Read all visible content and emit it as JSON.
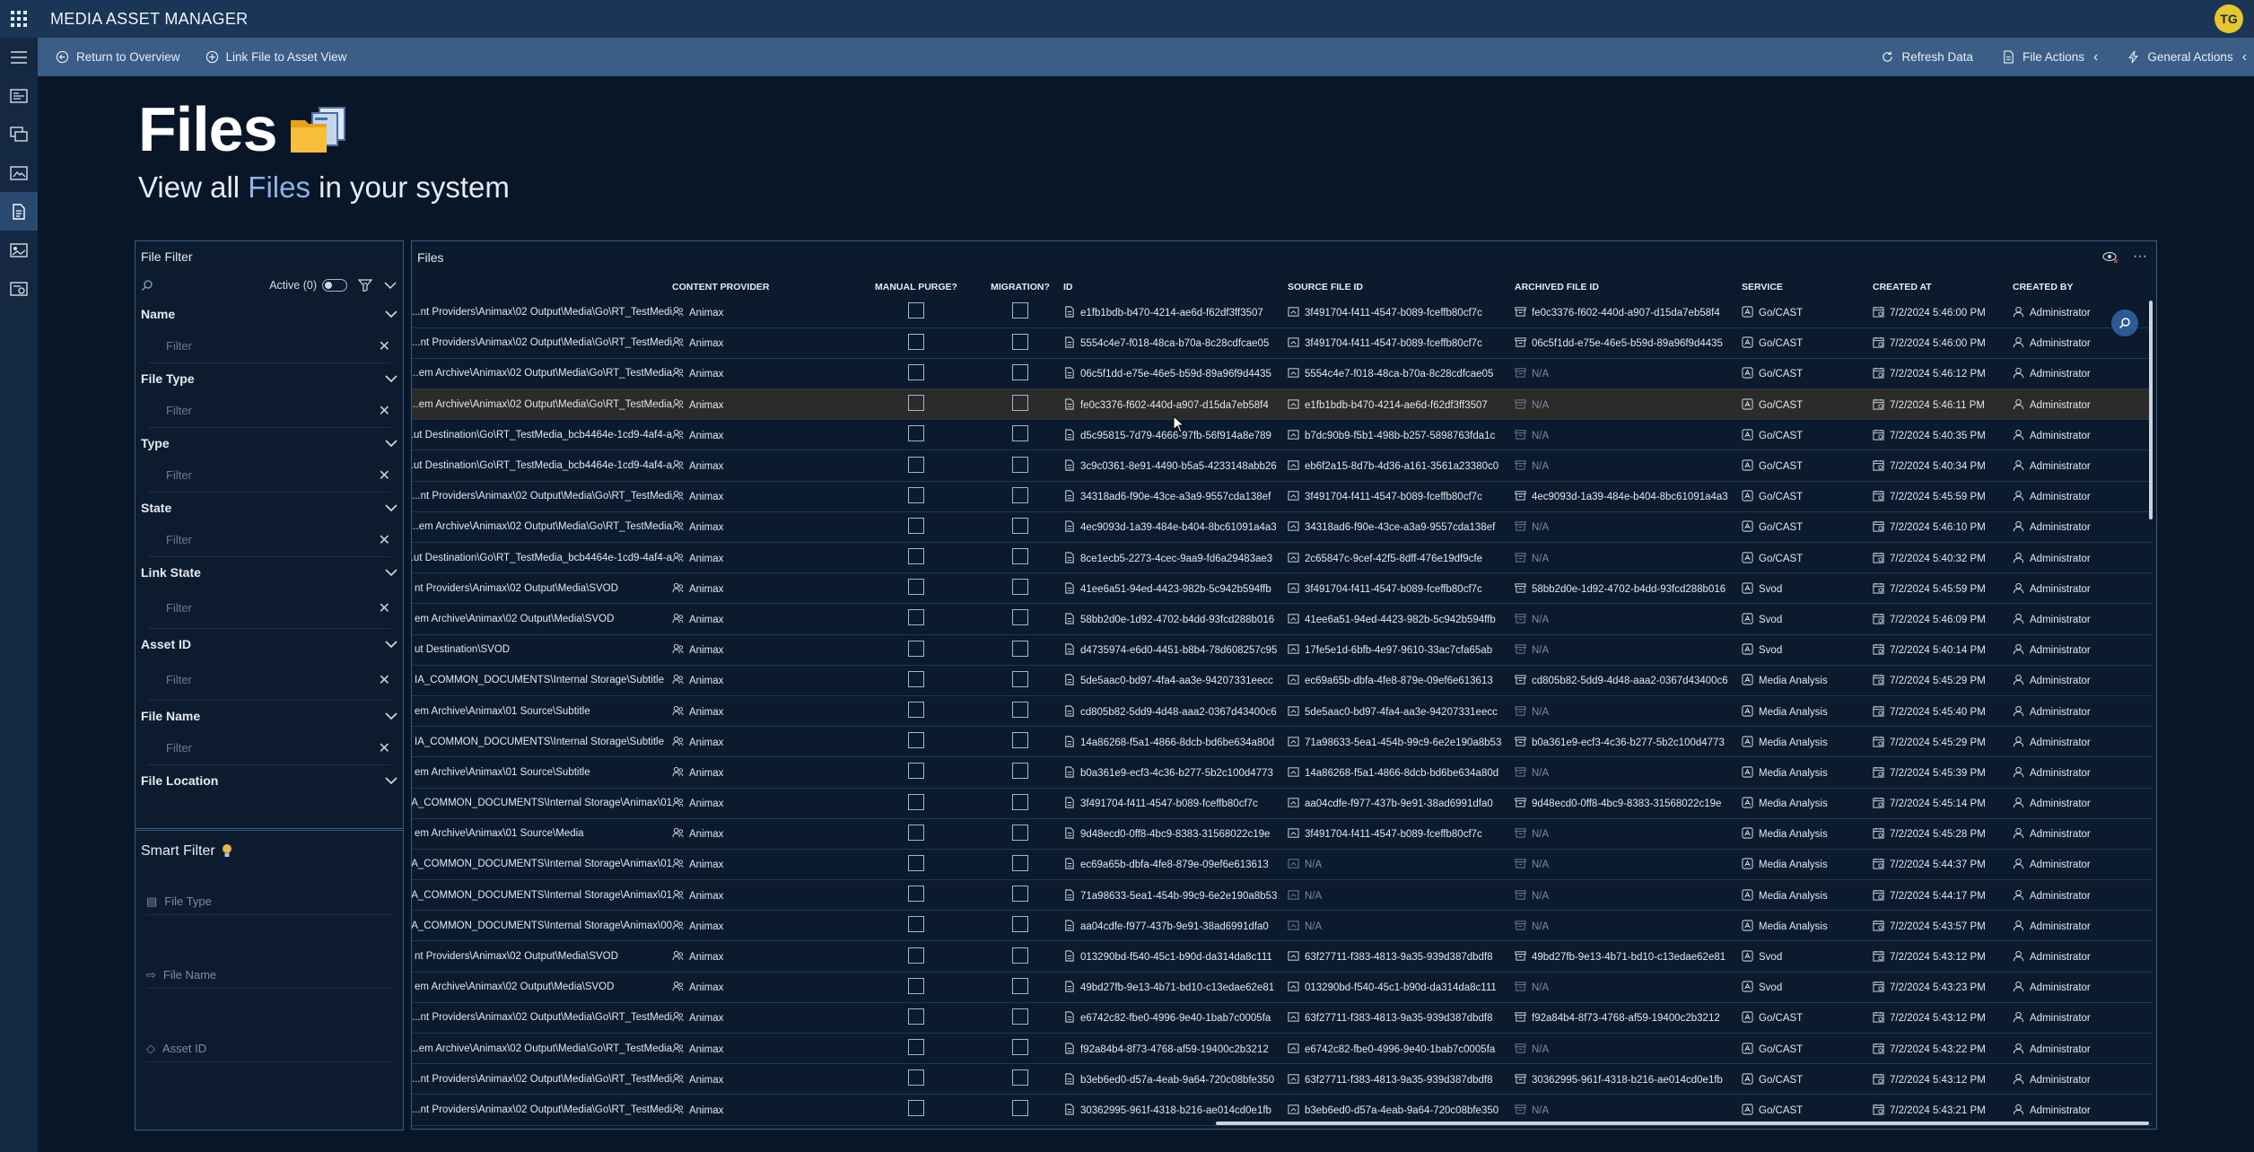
{
  "app": {
    "title": "MEDIA ASSET MANAGER",
    "user_initials": "TG"
  },
  "commands": {
    "return": "Return to Overview",
    "link": "Link File to Asset View",
    "refresh": "Refresh Data",
    "file_actions": "File Actions",
    "general_actions": "General Actions"
  },
  "hero": {
    "title": "Files",
    "subtitle_pre": "View all ",
    "subtitle_hl": "Files",
    "subtitle_post": " in your system"
  },
  "filter": {
    "title": "File Filter",
    "active": "Active (0)",
    "placeholder": "Filter",
    "groups": [
      "Name",
      "File Type",
      "Type",
      "State",
      "Link State",
      "Asset ID",
      "File Name",
      "File Location"
    ]
  },
  "smart": {
    "title": "Smart Filter",
    "items": [
      "File Type",
      "File Name",
      "Asset ID"
    ]
  },
  "files": {
    "title": "Files",
    "headers": [
      "CONTENT PROVIDER",
      "MANUAL PURGE?",
      "MIGRATION?",
      "ID",
      "SOURCE FILE ID",
      "ARCHIVED FILE ID",
      "SERVICE",
      "CREATED AT",
      "CREATED BY"
    ],
    "rows": [
      {
        "loc": "nt Providers\\Animax\\02 Output\\Media\\Go\\RT_TestMedi...",
        "cp": "Animax",
        "id": "e1fb1bdb-b470-4214-ae6d-f62df3ff3507",
        "src": "3f491704-f411-4547-b089-fceffb80cf7c",
        "arc": "fe0c3376-f602-440d-a907-d15da7eb58f4",
        "svc": "Go/CAST",
        "at": "7/2/2024 5:46:00 PM",
        "by": "Administrator"
      },
      {
        "loc": "nt Providers\\Animax\\02 Output\\Media\\Go\\RT_TestMedi...",
        "cp": "Animax",
        "id": "5554c4e7-f018-48ca-b70a-8c28cdfcae05",
        "src": "3f491704-f411-4547-b089-fceffb80cf7c",
        "arc": "06c5f1dd-e75e-46e5-b59d-89a96f9d4435",
        "svc": "Go/CAST",
        "at": "7/2/2024 5:46:00 PM",
        "by": "Administrator"
      },
      {
        "loc": "em Archive\\Animax\\02 Output\\Media\\Go\\RT_TestMedia...",
        "cp": "Animax",
        "id": "06c5f1dd-e75e-46e5-b59d-89a96f9d4435",
        "src": "5554c4e7-f018-48ca-b70a-8c28cdfcae05",
        "arc": "N/A",
        "svc": "Go/CAST",
        "at": "7/2/2024 5:46:12 PM",
        "by": "Administrator"
      },
      {
        "loc": "em Archive\\Animax\\02 Output\\Media\\Go\\RT_TestMedia...",
        "cp": "Animax",
        "id": "fe0c3376-f602-440d-a907-d15da7eb58f4",
        "src": "e1fb1bdb-b470-4214-ae6d-f62df3ff3507",
        "arc": "N/A",
        "svc": "Go/CAST",
        "at": "7/2/2024 5:46:11 PM",
        "by": "Administrator"
      },
      {
        "loc": "ut Destination\\Go\\RT_TestMedia_bcb4464e-1cd9-4af4-a...",
        "cp": "Animax",
        "id": "d5c95815-7d79-4666-97fb-56f914a8e789",
        "src": "b7dc90b9-f5b1-498b-b257-5898763fda1c",
        "arc": "N/A",
        "svc": "Go/CAST",
        "at": "7/2/2024 5:40:35 PM",
        "by": "Administrator"
      },
      {
        "loc": "ut Destination\\Go\\RT_TestMedia_bcb4464e-1cd9-4af4-a...",
        "cp": "Animax",
        "id": "3c9c0361-8e91-4490-b5a5-4233148abb26",
        "src": "eb6f2a15-8d7b-4d36-a161-3561a23380c0",
        "arc": "N/A",
        "svc": "Go/CAST",
        "at": "7/2/2024 5:40:34 PM",
        "by": "Administrator"
      },
      {
        "loc": "nt Providers\\Animax\\02 Output\\Media\\Go\\RT_TestMedi...",
        "cp": "Animax",
        "id": "34318ad6-f90e-43ce-a3a9-9557cda138ef",
        "src": "3f491704-f411-4547-b089-fceffb80cf7c",
        "arc": "4ec9093d-1a39-484e-b404-8bc61091a4a3",
        "svc": "Go/CAST",
        "at": "7/2/2024 5:45:59 PM",
        "by": "Administrator"
      },
      {
        "loc": "em Archive\\Animax\\02 Output\\Media\\Go\\RT_TestMedia...",
        "cp": "Animax",
        "id": "4ec9093d-1a39-484e-b404-8bc61091a4a3",
        "src": "34318ad6-f90e-43ce-a3a9-9557cda138ef",
        "arc": "N/A",
        "svc": "Go/CAST",
        "at": "7/2/2024 5:46:10 PM",
        "by": "Administrator"
      },
      {
        "loc": "ut Destination\\Go\\RT_TestMedia_bcb4464e-1cd9-4af4-a...",
        "cp": "Animax",
        "id": "8ce1ecb5-2273-4cec-9aa9-fd6a29483ae3",
        "src": "2c65847c-9cef-42f5-8dff-476e19df9cfe",
        "arc": "N/A",
        "svc": "Go/CAST",
        "at": "7/2/2024 5:40:32 PM",
        "by": "Administrator"
      },
      {
        "loc": "nt Providers\\Animax\\02 Output\\Media\\SVOD",
        "cp": "Animax",
        "id": "41ee6a51-94ed-4423-982b-5c942b594ffb",
        "src": "3f491704-f411-4547-b089-fceffb80cf7c",
        "arc": "58bb2d0e-1d92-4702-b4dd-93fcd288b016",
        "svc": "Svod",
        "at": "7/2/2024 5:45:59 PM",
        "by": "Administrator"
      },
      {
        "loc": "em Archive\\Animax\\02 Output\\Media\\SVOD",
        "cp": "Animax",
        "id": "58bb2d0e-1d92-4702-b4dd-93fcd288b016",
        "src": "41ee6a51-94ed-4423-982b-5c942b594ffb",
        "arc": "N/A",
        "svc": "Svod",
        "at": "7/2/2024 5:46:09 PM",
        "by": "Administrator"
      },
      {
        "loc": "ut Destination\\SVOD",
        "cp": "Animax",
        "id": "d4735974-e6d0-4451-b8b4-78d608257c95",
        "src": "17fe5e1d-6bfb-4e97-9610-33ac7cfa65ab",
        "arc": "N/A",
        "svc": "Svod",
        "at": "7/2/2024 5:40:14 PM",
        "by": "Administrator"
      },
      {
        "loc": "IA_COMMON_DOCUMENTS\\Internal Storage\\Subtitle",
        "cp": "Animax",
        "id": "5de5aac0-bd97-4fa4-aa3e-94207331eecc",
        "src": "ec69a65b-dbfa-4fe8-879e-09ef6e613613",
        "arc": "cd805b82-5dd9-4d48-aaa2-0367d43400c6",
        "svc": "Media Analysis",
        "at": "7/2/2024 5:45:29 PM",
        "by": "Administrator"
      },
      {
        "loc": "em Archive\\Animax\\01 Source\\Subtitle",
        "cp": "Animax",
        "id": "cd805b82-5dd9-4d48-aaa2-0367d43400c6",
        "src": "5de5aac0-bd97-4fa4-aa3e-94207331eecc",
        "arc": "N/A",
        "svc": "Media Analysis",
        "at": "7/2/2024 5:45:40 PM",
        "by": "Administrator"
      },
      {
        "loc": "IA_COMMON_DOCUMENTS\\Internal Storage\\Subtitle",
        "cp": "Animax",
        "id": "14a86268-f5a1-4866-8dcb-bd6be634a80d",
        "src": "71a98633-5ea1-454b-99c9-6e2e190a8b53",
        "arc": "b0a361e9-ecf3-4c36-b277-5b2c100d4773",
        "svc": "Media Analysis",
        "at": "7/2/2024 5:45:29 PM",
        "by": "Administrator"
      },
      {
        "loc": "em Archive\\Animax\\01 Source\\Subtitle",
        "cp": "Animax",
        "id": "b0a361e9-ecf3-4c36-b277-5b2c100d4773",
        "src": "14a86268-f5a1-4866-8dcb-bd6be634a80d",
        "arc": "N/A",
        "svc": "Media Analysis",
        "at": "7/2/2024 5:45:39 PM",
        "by": "Administrator"
      },
      {
        "loc": "IA_COMMON_DOCUMENTS\\Internal Storage\\Animax\\01 ...",
        "cp": "Animax",
        "id": "3f491704-f411-4547-b089-fceffb80cf7c",
        "src": "aa04cdfe-f977-437b-9e91-38ad6991dfa0",
        "arc": "9d48ecd0-0ff8-4bc9-8383-31568022c19e",
        "svc": "Media Analysis",
        "at": "7/2/2024 5:45:14 PM",
        "by": "Administrator"
      },
      {
        "loc": "em Archive\\Animax\\01 Source\\Media",
        "cp": "Animax",
        "id": "9d48ecd0-0ff8-4bc9-8383-31568022c19e",
        "src": "3f491704-f411-4547-b089-fceffb80cf7c",
        "arc": "N/A",
        "svc": "Media Analysis",
        "at": "7/2/2024 5:45:28 PM",
        "by": "Administrator"
      },
      {
        "loc": "IA_COMMON_DOCUMENTS\\Internal Storage\\Animax\\01 ...",
        "cp": "Animax",
        "id": "ec69a65b-dbfa-4fe8-879e-09ef6e613613",
        "src": "N/A",
        "arc": "N/A",
        "svc": "Media Analysis",
        "at": "7/2/2024 5:44:37 PM",
        "by": "Administrator"
      },
      {
        "loc": "IA_COMMON_DOCUMENTS\\Internal Storage\\Animax\\01 ...",
        "cp": "Animax",
        "id": "71a98633-5ea1-454b-99c9-6e2e190a8b53",
        "src": "N/A",
        "arc": "N/A",
        "svc": "Media Analysis",
        "at": "7/2/2024 5:44:17 PM",
        "by": "Administrator"
      },
      {
        "loc": "IA_COMMON_DOCUMENTS\\Internal Storage\\Animax\\00 ...",
        "cp": "Animax",
        "id": "aa04cdfe-f977-437b-9e91-38ad6991dfa0",
        "src": "N/A",
        "arc": "N/A",
        "svc": "Media Analysis",
        "at": "7/2/2024 5:43:57 PM",
        "by": "Administrator"
      },
      {
        "loc": "nt Providers\\Animax\\02 Output\\Media\\SVOD",
        "cp": "Animax",
        "id": "013290bd-f540-45c1-b90d-da314da8c111",
        "src": "63f27711-f383-4813-9a35-939d387dbdf8",
        "arc": "49bd27fb-9e13-4b71-bd10-c13edae62e81",
        "svc": "Svod",
        "at": "7/2/2024 5:43:12 PM",
        "by": "Administrator"
      },
      {
        "loc": "em Archive\\Animax\\02 Output\\Media\\SVOD",
        "cp": "Animax",
        "id": "49bd27fb-9e13-4b71-bd10-c13edae62e81",
        "src": "013290bd-f540-45c1-b90d-da314da8c111",
        "arc": "N/A",
        "svc": "Svod",
        "at": "7/2/2024 5:43:23 PM",
        "by": "Administrator"
      },
      {
        "loc": "nt Providers\\Animax\\02 Output\\Media\\Go\\RT_TestMedi...",
        "cp": "Animax",
        "id": "e6742c82-fbe0-4996-9e40-1bab7c0005fa",
        "src": "63f27711-f383-4813-9a35-939d387dbdf8",
        "arc": "f92a84b4-8f73-4768-af59-19400c2b3212",
        "svc": "Go/CAST",
        "at": "7/2/2024 5:43:12 PM",
        "by": "Administrator"
      },
      {
        "loc": "em Archive\\Animax\\02 Output\\Media\\Go\\RT_TestMedia...",
        "cp": "Animax",
        "id": "f92a84b4-8f73-4768-af59-19400c2b3212",
        "src": "e6742c82-fbe0-4996-9e40-1bab7c0005fa",
        "arc": "N/A",
        "svc": "Go/CAST",
        "at": "7/2/2024 5:43:22 PM",
        "by": "Administrator"
      },
      {
        "loc": "nt Providers\\Animax\\02 Output\\Media\\Go\\RT_TestMedi...",
        "cp": "Animax",
        "id": "b3eb6ed0-d57a-4eab-9a64-720c08bfe350",
        "src": "63f27711-f383-4813-9a35-939d387dbdf8",
        "arc": "30362995-961f-4318-b216-ae014cd0e1fb",
        "svc": "Go/CAST",
        "at": "7/2/2024 5:43:12 PM",
        "by": "Administrator"
      },
      {
        "loc": "nt Providers\\Animax\\02 Output\\Media\\Go\\RT_TestMedi...",
        "cp": "Animax",
        "id": "30362995-961f-4318-b216-ae014cd0e1fb",
        "src": "b3eb6ed0-d57a-4eab-9a64-720c08bfe350",
        "arc": "N/A",
        "svc": "Go/CAST",
        "at": "7/2/2024 5:43:21 PM",
        "by": "Administrator"
      }
    ]
  }
}
